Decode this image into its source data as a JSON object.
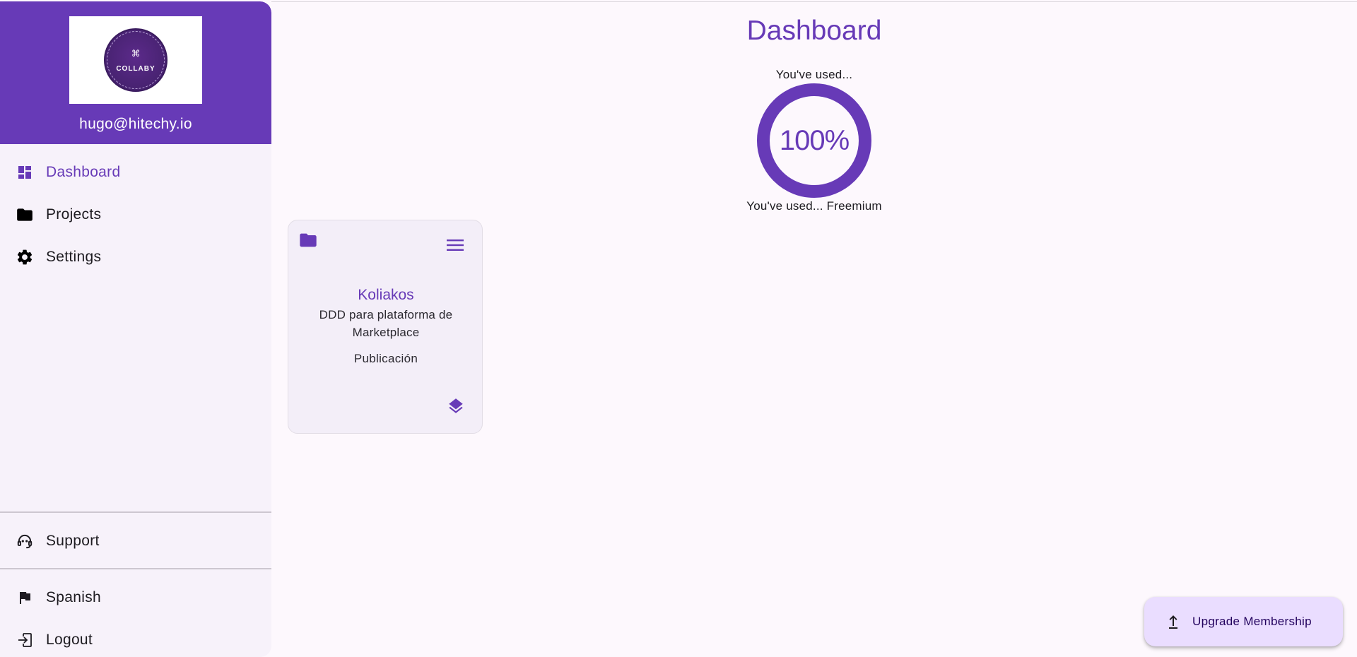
{
  "colors": {
    "accent": "#673ab7",
    "sidebar_bg": "#f7f2fa",
    "page_bg": "#fdf8fd",
    "card_bg": "#f3eef8",
    "fab_bg": "#eaddff"
  },
  "sidebar": {
    "logo_text": "COLLABY",
    "user_email": "hugo@hitechy.io",
    "nav_items": [
      {
        "label": "Dashboard",
        "icon": "dashboard-icon",
        "active": true
      },
      {
        "label": "Projects",
        "icon": "folder-icon",
        "active": false
      },
      {
        "label": "Settings",
        "icon": "gear-icon",
        "active": false
      }
    ],
    "support": {
      "label": "Support",
      "icon": "support-agent-icon"
    },
    "language": {
      "label": "Spanish",
      "icon": "flag-icon"
    },
    "logout": {
      "label": "Logout",
      "icon": "logout-icon"
    }
  },
  "main": {
    "title": "Dashboard",
    "usage": {
      "top_label": "You've used...",
      "percent": 100,
      "percent_label": "100%",
      "bottom_label": "You've used... Freemium"
    },
    "projects": [
      {
        "title": "Koliakos",
        "description": "DDD para plataforma de Marketplace",
        "status": "Publicación"
      }
    ]
  },
  "upgrade": {
    "label": "Upgrade Membership",
    "icon": "upload-arrow-icon"
  }
}
